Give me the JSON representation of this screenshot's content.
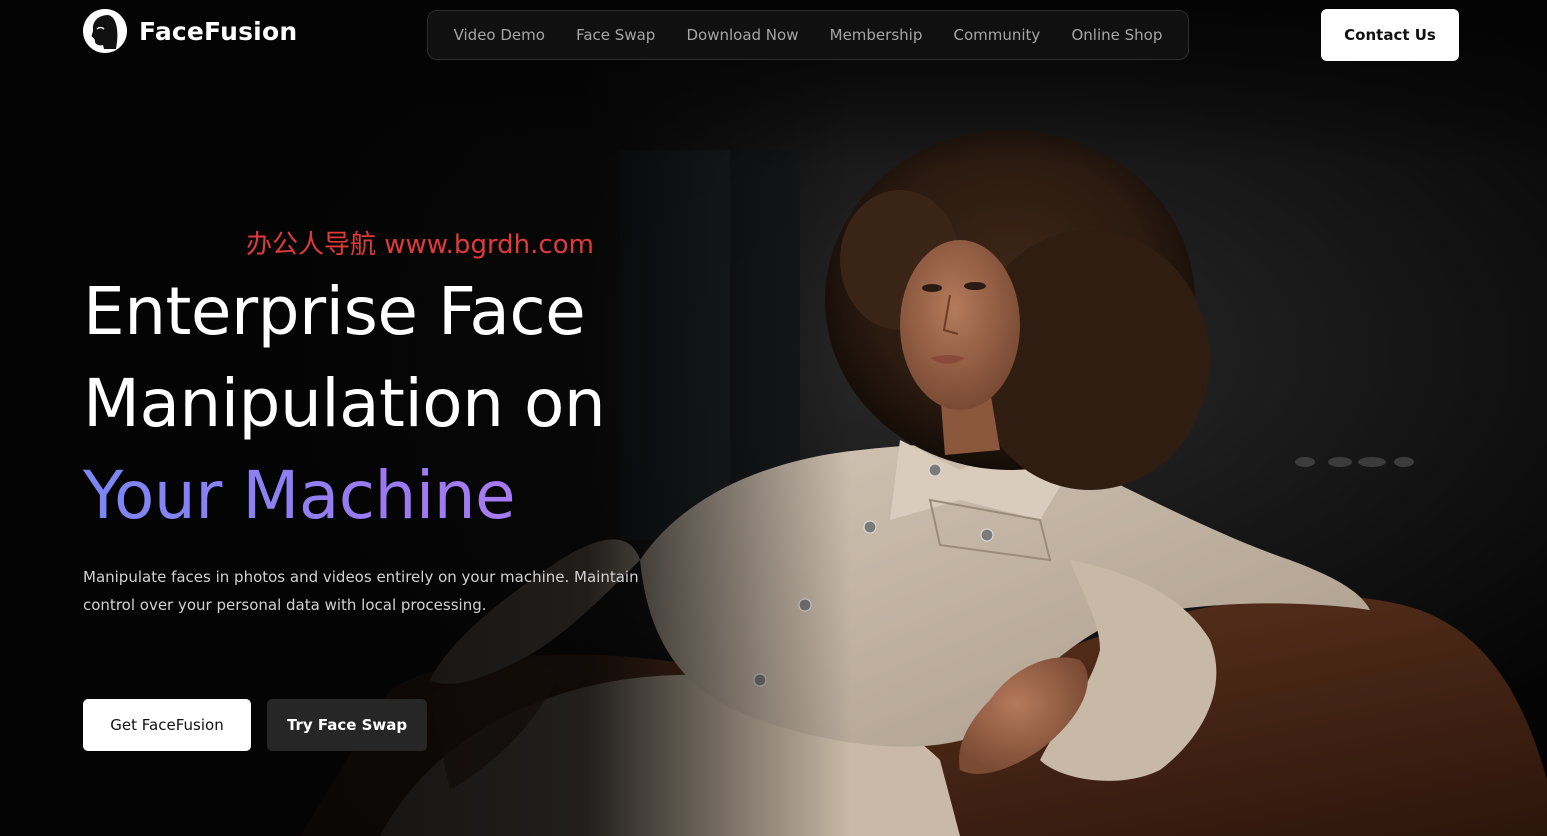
{
  "brand": {
    "name": "FaceFusion",
    "logo_icon": "face-profile-icon"
  },
  "nav": {
    "items": [
      {
        "label": "Video Demo"
      },
      {
        "label": "Face Swap"
      },
      {
        "label": "Download Now"
      },
      {
        "label": "Membership"
      },
      {
        "label": "Community"
      },
      {
        "label": "Online Shop"
      }
    ]
  },
  "header": {
    "contact_label": "Contact Us"
  },
  "watermark": {
    "text": "办公人导航 www.bgrdh.com"
  },
  "hero": {
    "headline_line1": "Enterprise Face",
    "headline_line2": "Manipulation on",
    "headline_accent": "Your Machine",
    "description": "Manipulate faces in photos and videos entirely on your machine. Maintain control over your personal data with local processing.",
    "primary_cta": "Get FaceFusion",
    "secondary_cta": "Try Face Swap"
  },
  "colors": {
    "background": "#040404",
    "accent_gradient_start": "#7b87f5",
    "accent_gradient_end": "#b07cf0",
    "watermark": "#e03a3a"
  }
}
